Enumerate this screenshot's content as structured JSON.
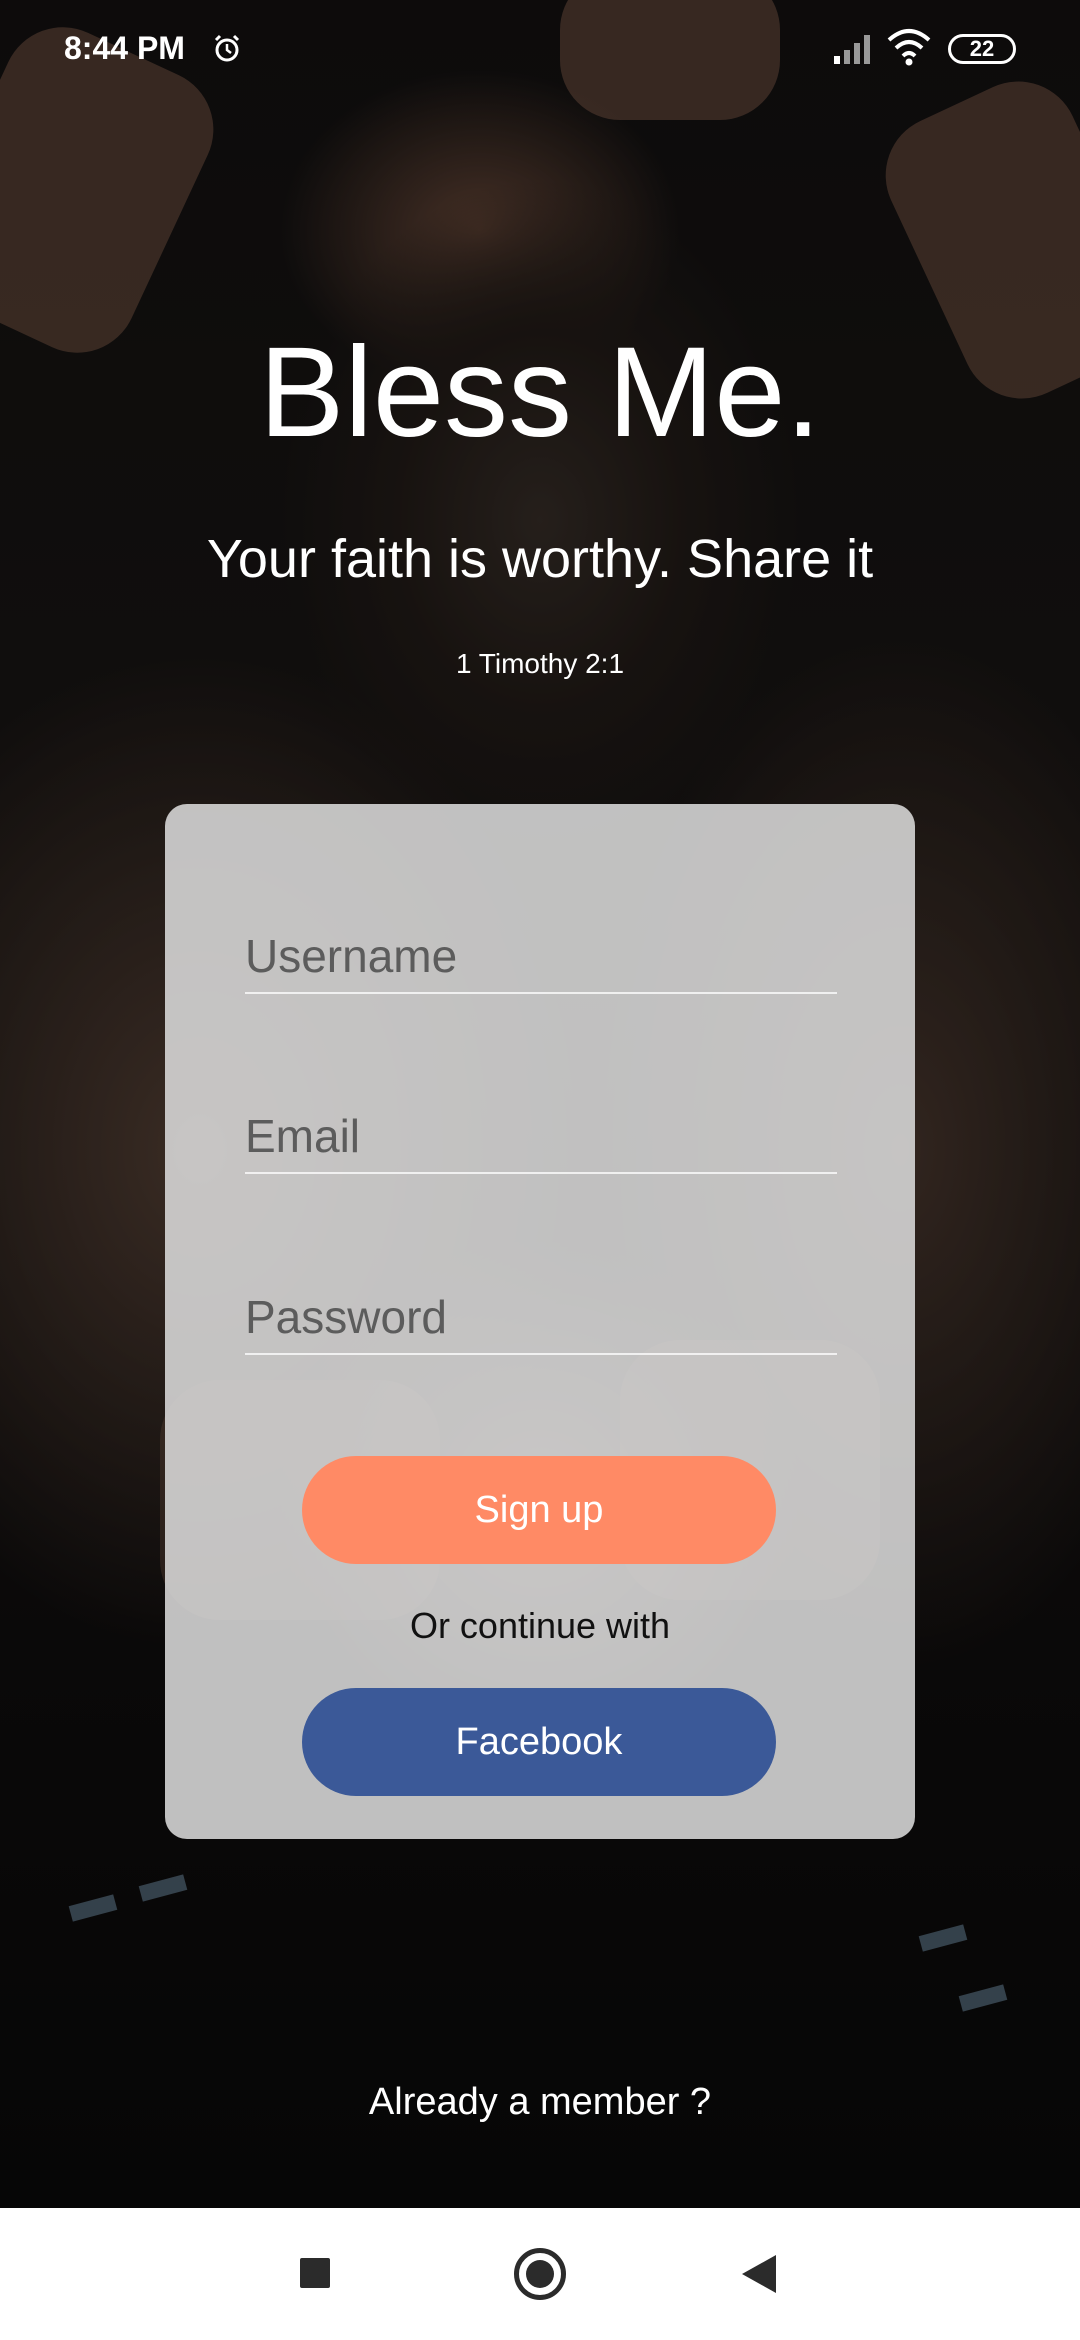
{
  "status_bar": {
    "time": "8:44 PM",
    "battery": "22",
    "icons": [
      "alarm-icon",
      "signal-icon",
      "wifi-icon",
      "battery-icon"
    ]
  },
  "header": {
    "title": "Bless Me.",
    "tagline": "Your faith is worthy. Share it",
    "verse": "1 Timothy 2:1"
  },
  "form": {
    "username_placeholder": "Username",
    "username_value": "",
    "email_placeholder": "Email",
    "email_value": "",
    "password_placeholder": "Password",
    "password_value": "",
    "signup_label": "Sign up",
    "or_text": "Or continue with",
    "facebook_label": "Facebook"
  },
  "footer": {
    "already_member": "Already a member ?"
  },
  "nav_bar": {
    "icons": [
      "recent-apps-icon",
      "home-icon",
      "back-icon"
    ]
  },
  "colors": {
    "signup_button": "#ff8a65",
    "facebook_button": "#3b5998",
    "card_background": "#dedede"
  }
}
